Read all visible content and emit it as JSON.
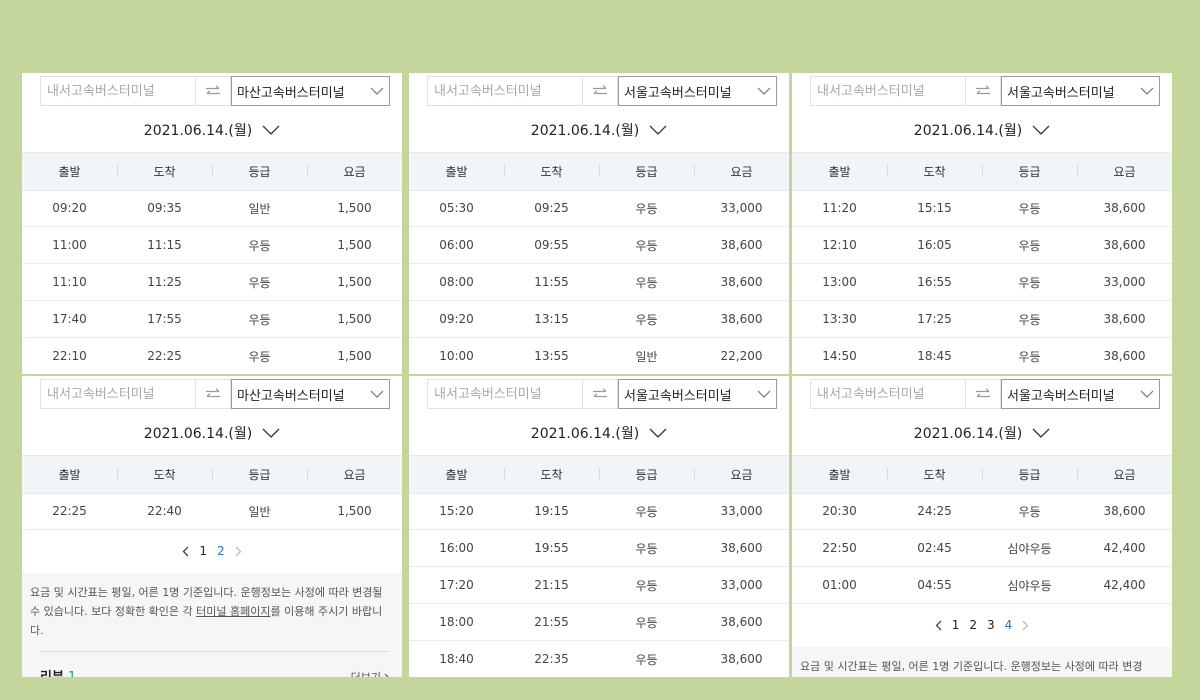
{
  "colors": {
    "background": "#c4d69b",
    "page_active": "#2b6fd6",
    "review_count": "#1a9e6e"
  },
  "columns": [
    "출발",
    "도착",
    "등급",
    "요금"
  ],
  "panels": [
    {
      "origin_placeholder": "내서고속버스터미널",
      "destination": "마산고속버스터미널",
      "date": "2021.06.14.(월)",
      "rows": [
        [
          "09:20",
          "09:35",
          "일반",
          "1,500"
        ],
        [
          "11:00",
          "11:15",
          "우등",
          "1,500"
        ],
        [
          "11:10",
          "11:25",
          "우등",
          "1,500"
        ],
        [
          "17:40",
          "17:55",
          "우등",
          "1,500"
        ],
        [
          "22:10",
          "22:25",
          "우등",
          "1,500"
        ]
      ]
    },
    {
      "origin_placeholder": "내서고속버스터미널",
      "destination": "서울고속버스터미널",
      "date": "2021.06.14.(월)",
      "rows": [
        [
          "05:30",
          "09:25",
          "우등",
          "33,000"
        ],
        [
          "06:00",
          "09:55",
          "우등",
          "38,600"
        ],
        [
          "08:00",
          "11:55",
          "우등",
          "38,600"
        ],
        [
          "09:20",
          "13:15",
          "우등",
          "38,600"
        ],
        [
          "10:00",
          "13:55",
          "일반",
          "22,200"
        ]
      ]
    },
    {
      "origin_placeholder": "내서고속버스터미널",
      "destination": "서울고속버스터미널",
      "date": "2021.06.14.(월)",
      "rows": [
        [
          "11:20",
          "15:15",
          "우등",
          "38,600"
        ],
        [
          "12:10",
          "16:05",
          "우등",
          "38,600"
        ],
        [
          "13:00",
          "16:55",
          "우등",
          "33,000"
        ],
        [
          "13:30",
          "17:25",
          "우등",
          "38,600"
        ],
        [
          "14:50",
          "18:45",
          "우등",
          "38,600"
        ]
      ]
    },
    {
      "origin_placeholder": "내서고속버스터미널",
      "destination": "마산고속버스터미널",
      "date": "2021.06.14.(월)",
      "rows": [
        [
          "22:25",
          "22:40",
          "일반",
          "1,500"
        ]
      ],
      "pages": [
        "1",
        "2"
      ],
      "current_page": "1",
      "notice_before_link": "요금 및 시간표는 평일, 어른 1명 기준입니다. 운행정보는 사정에 따라 변경될 수 있습니다. 보다 정확한 확인은 각 ",
      "notice_link": "터미널 홈페이지",
      "notice_after_link": "를 이용해 주시기 바랍니다.",
      "review_label": "리뷰",
      "review_count": "1",
      "more_label": "더보기"
    },
    {
      "origin_placeholder": "내서고속버스터미널",
      "destination": "서울고속버스터미널",
      "date": "2021.06.14.(월)",
      "rows": [
        [
          "15:20",
          "19:15",
          "우등",
          "33,000"
        ],
        [
          "16:00",
          "19:55",
          "우등",
          "38,600"
        ],
        [
          "17:20",
          "21:15",
          "우등",
          "33,000"
        ],
        [
          "18:00",
          "21:55",
          "우등",
          "38,600"
        ],
        [
          "18:40",
          "22:35",
          "우등",
          "38,600"
        ]
      ]
    },
    {
      "origin_placeholder": "내서고속버스터미널",
      "destination": "서울고속버스터미널",
      "date": "2021.06.14.(월)",
      "rows": [
        [
          "20:30",
          "24:25",
          "우등",
          "38,600"
        ],
        [
          "22:50",
          "02:45",
          "심야우등",
          "42,400"
        ],
        [
          "01:00",
          "04:55",
          "심야우등",
          "42,400"
        ]
      ],
      "pages": [
        "1",
        "2",
        "3",
        "4"
      ],
      "current_page": "4",
      "notice_text": "요금 및 시간표는 평일, 어른 1명 기준입니다. 운행정보는 사정에 따라 변경"
    }
  ]
}
